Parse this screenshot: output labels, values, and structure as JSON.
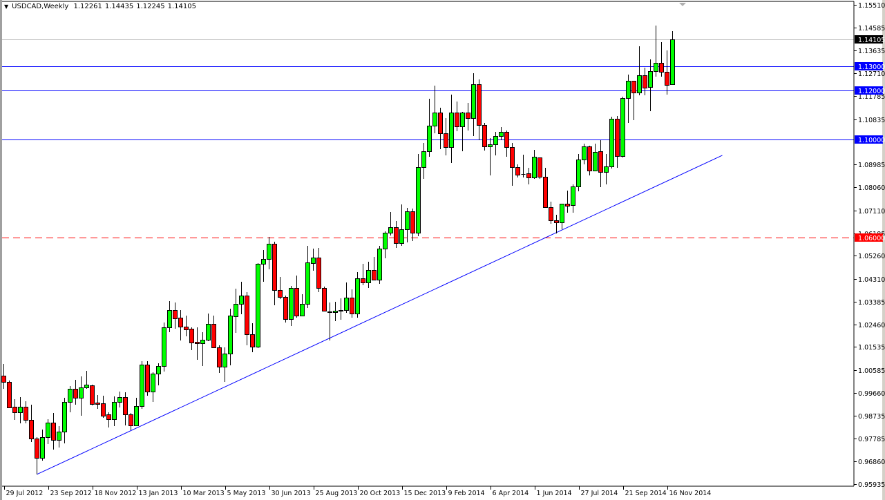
{
  "header": {
    "symbol_timeframe": "USDCAD,Weekly",
    "open": "1.12261",
    "high": "1.14435",
    "low": "1.12245",
    "close": "1.14105"
  },
  "chart_data": {
    "type": "candlestick",
    "title": "USDCAD,Weekly",
    "xlabel": "",
    "ylabel": "",
    "ylim": [
      0.95935,
      1.1551
    ],
    "grid": false,
    "colors": {
      "up": "#00ff00",
      "down": "#ff0000",
      "outline": "#000000",
      "support_line": "#0000ff",
      "key_level_red": "#ff0000",
      "current_price": "#000000",
      "current_line": "#c0c0c0"
    },
    "x_tick_labels": [
      {
        "bar": 0,
        "label": "29 Jul 2012"
      },
      {
        "bar": 8,
        "label": "23 Sep 2012"
      },
      {
        "bar": 16,
        "label": "18 Nov 2012"
      },
      {
        "bar": 24,
        "label": "13 Jan 2013"
      },
      {
        "bar": 32,
        "label": "10 Mar 2013"
      },
      {
        "bar": 40,
        "label": "5 May 2013"
      },
      {
        "bar": 48,
        "label": "30 Jun 2013"
      },
      {
        "bar": 56,
        "label": "25 Aug 2013"
      },
      {
        "bar": 64,
        "label": "20 Oct 2013"
      },
      {
        "bar": 72,
        "label": "15 Dec 2013"
      },
      {
        "bar": 80,
        "label": "9 Feb 2014"
      },
      {
        "bar": 88,
        "label": "6 Apr 2014"
      },
      {
        "bar": 96,
        "label": "1 Jun 2014"
      },
      {
        "bar": 104,
        "label": "27 Jul 2014"
      },
      {
        "bar": 112,
        "label": "21 Sep 2014"
      },
      {
        "bar": 120,
        "label": "16 Nov 2014"
      }
    ],
    "y_tick_labels": [
      "1.15510",
      "1.14585",
      "1.13635",
      "1.12710",
      "1.11785",
      "1.10835",
      "1.08985",
      "1.08060",
      "1.07110",
      "1.06185",
      "1.05260",
      "1.04310",
      "1.03385",
      "1.02460",
      "1.01535",
      "1.00585",
      "0.99660",
      "0.98735",
      "0.97785",
      "0.96860",
      "0.95935"
    ],
    "horizontal_levels": [
      {
        "price": 1.13,
        "label": "1.13000",
        "color": "#0000ff",
        "style": "solid"
      },
      {
        "price": 1.12,
        "label": "1.12000",
        "color": "#0000ff",
        "style": "solid"
      },
      {
        "price": 1.1,
        "label": "1.10000",
        "color": "#0000ff",
        "style": "solid"
      },
      {
        "price": 1.06,
        "label": "1.06000",
        "color": "#ff0000",
        "style": "dashed"
      }
    ],
    "current_price": {
      "price": 1.14105,
      "label": "1.14105"
    },
    "trendline": {
      "start_bar": 6,
      "start_price": 0.96334,
      "end_bar": 130,
      "end_price": 1.09362,
      "color": "#0000ff"
    },
    "ohlc_fields": [
      "open",
      "high",
      "low",
      "close"
    ],
    "candles": [
      [
        1.00366,
        1.00846,
        0.9983,
        1.00112
      ],
      [
        1.00112,
        1.00169,
        0.99041,
        0.99069
      ],
      [
        0.99097,
        0.99407,
        0.98561,
        0.98872
      ],
      [
        0.98872,
        0.99492,
        0.9842,
        0.99097
      ],
      [
        0.99097,
        0.99323,
        0.9842,
        0.98561
      ],
      [
        0.98561,
        0.99182,
        0.97659,
        0.978
      ],
      [
        0.978,
        0.97856,
        0.96334,
        0.9701
      ],
      [
        0.9701,
        0.98167,
        0.96898,
        0.97856
      ],
      [
        0.97856,
        0.9859,
        0.97574,
        0.98449
      ],
      [
        0.98449,
        0.98843,
        0.97349,
        0.97744
      ],
      [
        0.97744,
        0.98308,
        0.97433,
        0.98082
      ],
      [
        0.98082,
        0.99464,
        0.97603,
        0.99295
      ],
      [
        0.99295,
        0.99943,
        0.98872,
        0.9983
      ],
      [
        0.9983,
        1.00197,
        0.99182,
        0.99464
      ],
      [
        0.99464,
        1.00338,
        0.98731,
        0.99887
      ],
      [
        0.99887,
        1.00564,
        0.9983,
        1.0
      ],
      [
        0.99972,
        1.0,
        0.99154,
        0.9921
      ],
      [
        0.99266,
        0.99577,
        0.99013,
        0.9921
      ],
      [
        0.99238,
        0.99548,
        0.98646,
        0.98731
      ],
      [
        0.98787,
        0.98872,
        0.98251,
        0.9859
      ],
      [
        0.9859,
        0.9952,
        0.98308,
        0.99295
      ],
      [
        0.99295,
        0.99718,
        0.99069,
        0.99492
      ],
      [
        0.99492,
        0.9969,
        0.98336,
        0.98787
      ],
      [
        0.98787,
        0.98843,
        0.98138,
        0.98336
      ],
      [
        0.98336,
        0.99464,
        0.98308,
        0.99125
      ],
      [
        0.99125,
        1.00958,
        0.99013,
        1.00818
      ],
      [
        1.00818,
        1.00958,
        0.99548,
        0.99718
      ],
      [
        0.99718,
        1.00507,
        0.99295,
        1.00451
      ],
      [
        1.00451,
        1.00874,
        0.99972,
        1.00761
      ],
      [
        1.00761,
        1.02538,
        1.00535,
        1.0234
      ],
      [
        1.0234,
        1.03412,
        1.02143,
        1.03045
      ],
      [
        1.03045,
        1.03355,
        1.02284,
        1.02707
      ],
      [
        1.02735,
        1.03045,
        1.01804,
        1.02368
      ],
      [
        1.02368,
        1.0282,
        1.01974,
        1.02256
      ],
      [
        1.02284,
        1.0234,
        1.0141,
        1.0172
      ],
      [
        1.01748,
        1.0234,
        1.01015,
        1.01692
      ],
      [
        1.01692,
        1.02143,
        1.00761,
        1.01833
      ],
      [
        1.01833,
        1.02904,
        1.01776,
        1.02481
      ],
      [
        1.02481,
        1.0282,
        1.01494,
        1.01523
      ],
      [
        1.01523,
        1.01607,
        1.00479,
        1.00733
      ],
      [
        1.00733,
        1.01523,
        1.00112,
        1.01269
      ],
      [
        1.01269,
        1.03102,
        1.00789,
        1.0282
      ],
      [
        1.02791,
        1.03919,
        1.02115,
        1.03299
      ],
      [
        1.03299,
        1.04201,
        1.02876,
        1.03637
      ],
      [
        1.03637,
        1.03778,
        1.01607,
        1.02058
      ],
      [
        1.02058,
        1.02509,
        1.01325,
        1.01551
      ],
      [
        1.01551,
        1.04963,
        1.01494,
        1.04935
      ],
      [
        1.04935,
        1.05499,
        1.04201,
        1.05132
      ],
      [
        1.05132,
        1.06035,
        1.04709,
        1.05753
      ],
      [
        1.05753,
        1.05837,
        1.03243,
        1.03863
      ],
      [
        1.03863,
        1.04399,
        1.03496,
        1.03581
      ],
      [
        1.03581,
        1.03637,
        1.02538,
        1.02679
      ],
      [
        1.02679,
        1.04032,
        1.02397,
        1.03948
      ],
      [
        1.03948,
        1.04455,
        1.02735,
        1.0282
      ],
      [
        1.0282,
        1.03694,
        1.02791,
        1.03299
      ],
      [
        1.03299,
        1.05668,
        1.0313,
        1.04991
      ],
      [
        1.04963,
        1.05555,
        1.04653,
        1.05188
      ],
      [
        1.05188,
        1.05583,
        1.03778,
        1.03948
      ],
      [
        1.03948,
        1.04004,
        1.03017,
        1.03017
      ],
      [
        1.02989,
        1.03355,
        1.01804,
        1.02961
      ],
      [
        1.02961,
        1.03384,
        1.02594,
        1.03017
      ],
      [
        1.03017,
        1.03525,
        1.0265,
        1.03045
      ],
      [
        1.03045,
        1.04173,
        1.02932,
        1.03553
      ],
      [
        1.03553,
        1.03891,
        1.02735,
        1.02904
      ],
      [
        1.02904,
        1.04596,
        1.02735,
        1.04342
      ],
      [
        1.04342,
        1.04935,
        1.0406,
        1.04173
      ],
      [
        1.04173,
        1.05019,
        1.03948,
        1.04681
      ],
      [
        1.04681,
        1.05217,
        1.04258,
        1.04286
      ],
      [
        1.04286,
        1.05668,
        1.04117,
        1.05555
      ],
      [
        1.05555,
        1.0626,
        1.0516,
        1.06203
      ],
      [
        1.06203,
        1.0705,
        1.06091,
        1.06429
      ],
      [
        1.06429,
        1.06683,
        1.05583,
        1.05781
      ],
      [
        1.05781,
        1.0736,
        1.05668,
        1.06345
      ],
      [
        1.06345,
        1.07219,
        1.05809,
        1.07078
      ],
      [
        1.07078,
        1.07191,
        1.05865,
        1.06203
      ],
      [
        1.06203,
        1.09418,
        1.06063,
        1.08883
      ],
      [
        1.08883,
        1.0987,
        1.08403,
        1.09531
      ],
      [
        1.09531,
        1.11674,
        1.09306,
        1.10575
      ],
      [
        1.10575,
        1.1221,
        1.10264,
        1.11111
      ],
      [
        1.11111,
        1.11308,
        1.09616,
        1.10264
      ],
      [
        1.10264,
        1.10885,
        1.09362,
        1.09701
      ],
      [
        1.09701,
        1.11844,
        1.09052,
        1.11111
      ],
      [
        1.11111,
        1.11562,
        1.10349,
        1.10546
      ],
      [
        1.10546,
        1.11139,
        1.09531,
        1.11111
      ],
      [
        1.11111,
        1.11505,
        1.10377,
        1.10885
      ],
      [
        1.10885,
        1.12718,
        1.10151,
        1.12267
      ],
      [
        1.12267,
        1.12464,
        1.09982,
        1.10603
      ],
      [
        1.10603,
        1.10687,
        1.09559,
        1.09729
      ],
      [
        1.09729,
        1.10067,
        1.08544,
        1.09813
      ],
      [
        1.09813,
        1.10321,
        1.09362,
        1.10151
      ],
      [
        1.10151,
        1.10518,
        1.09982,
        1.10321
      ],
      [
        1.10321,
        1.10377,
        1.09306,
        1.09701
      ],
      [
        1.09701,
        1.0987,
        1.08121,
        1.08883
      ],
      [
        1.08883,
        1.08995,
        1.0846,
        1.08572
      ],
      [
        1.08601,
        1.0939,
        1.0846,
        1.08601
      ],
      [
        1.08629,
        1.08855,
        1.08178,
        1.0846
      ],
      [
        1.0846,
        1.09588,
        1.08403,
        1.09306
      ],
      [
        1.09277,
        1.09277,
        1.08403,
        1.08488
      ],
      [
        1.08488,
        1.08855,
        1.07247,
        1.07247
      ],
      [
        1.07247,
        1.07473,
        1.0657,
        1.06711
      ],
      [
        1.06711,
        1.06937,
        1.06175,
        1.06627
      ],
      [
        1.06627,
        1.07388,
        1.06345,
        1.07388
      ],
      [
        1.07388,
        1.07924,
        1.07021,
        1.07303
      ],
      [
        1.07332,
        1.08178,
        1.07021,
        1.08093
      ],
      [
        1.08093,
        1.09418,
        1.07896,
        1.09193
      ],
      [
        1.09193,
        1.09841,
        1.08995,
        1.09729
      ],
      [
        1.09729,
        1.09757,
        1.08544,
        1.08742
      ],
      [
        1.08742,
        1.09841,
        1.08713,
        1.09503
      ],
      [
        1.09531,
        1.09982,
        1.08065,
        1.08685
      ],
      [
        1.08685,
        1.09418,
        1.08178,
        1.08911
      ],
      [
        1.08911,
        1.10941,
        1.08826,
        1.10857
      ],
      [
        1.10857,
        1.10969,
        1.08855,
        1.09334
      ],
      [
        1.09334,
        1.11759,
        1.09277,
        1.11703
      ],
      [
        1.11703,
        1.12661,
        1.10687,
        1.12408
      ],
      [
        1.12408,
        1.12408,
        1.108,
        1.11928
      ],
      [
        1.11928,
        1.13818,
        1.11815,
        1.12633
      ],
      [
        1.12633,
        1.12943,
        1.11815,
        1.12126
      ],
      [
        1.12154,
        1.13282,
        1.11167,
        1.12802
      ],
      [
        1.12802,
        1.14664,
        1.12577,
        1.13141
      ],
      [
        1.13141,
        1.13987,
        1.12577,
        1.12774
      ],
      [
        1.12774,
        1.13648,
        1.11844,
        1.12238
      ],
      [
        1.12261,
        1.14435,
        1.12245,
        1.14105
      ]
    ]
  }
}
